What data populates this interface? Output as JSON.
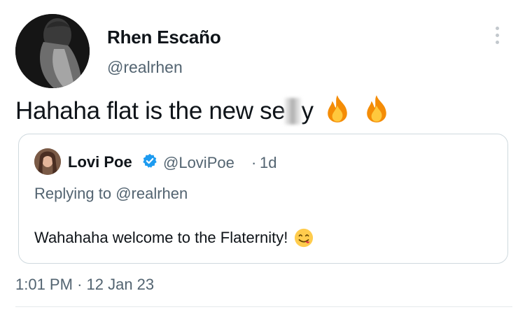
{
  "tweet": {
    "author_name": "Rhen Escaño",
    "author_handle": "@realrhen",
    "text_before_blur": "Hahaha flat is the new se",
    "text_after_blur": "y",
    "emojis": [
      "fire-emoji",
      "fire-emoji"
    ],
    "timestamp_time": "1:01 PM",
    "timestamp_separator": "·",
    "timestamp_date": "12 Jan 23"
  },
  "quoted_tweet": {
    "author_name": "Lovi Poe",
    "verified": true,
    "author_handle": "@LoviPoe",
    "separator": "·",
    "time_ago": "1d",
    "replying_prefix": "Replying to ",
    "replying_to": "@realrhen",
    "text": "Wahahaha welcome to the Flaternity!",
    "emoji": "face-savoring-food-emoji"
  },
  "colors": {
    "text_primary": "#0f1419",
    "text_secondary": "#536471",
    "border": "#cfd9de",
    "verified_blue": "#1d9bf0"
  }
}
